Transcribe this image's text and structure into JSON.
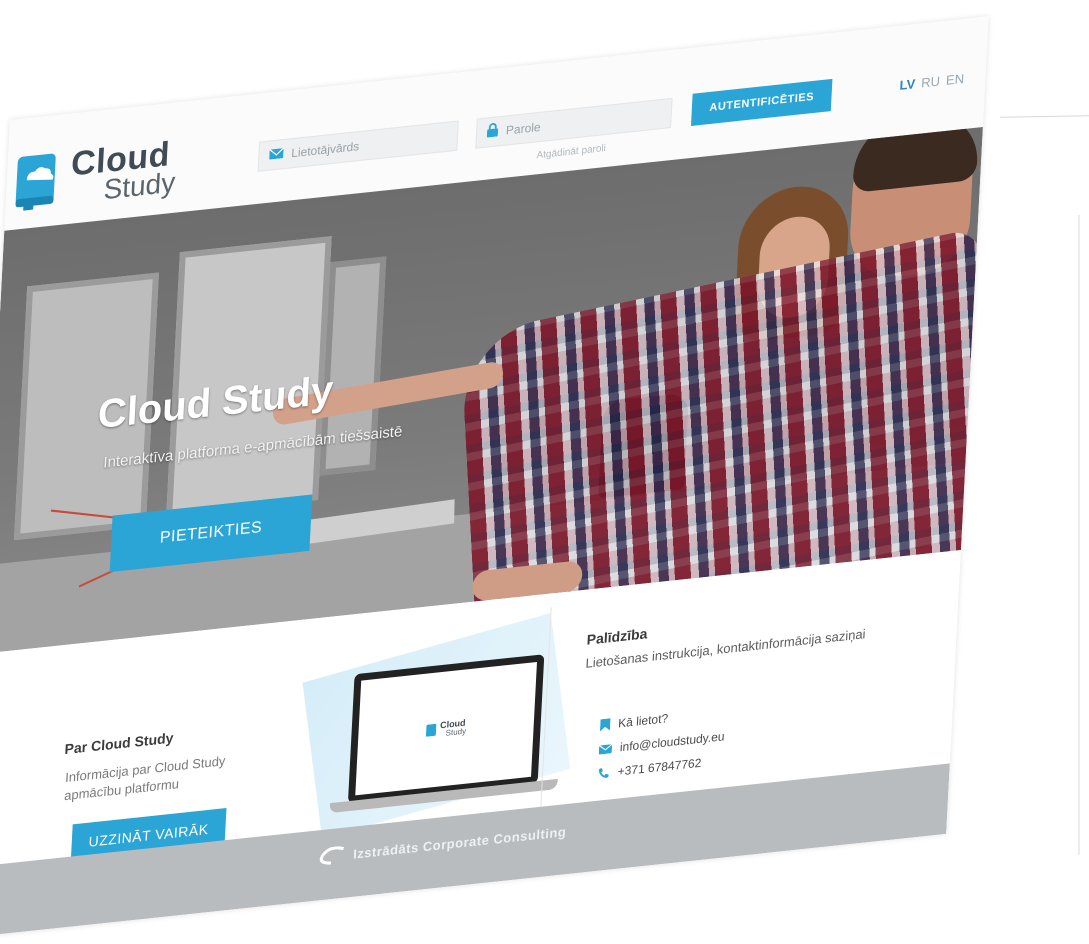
{
  "brand": {
    "line1": "Cloud",
    "line2": "Study"
  },
  "login": {
    "username_placeholder": "Lietotājvārds",
    "password_placeholder": "Parole",
    "forgot_label": "Atgādināt paroli",
    "submit_label": "AUTENTIFICĒTIES"
  },
  "languages": [
    {
      "code": "LV",
      "active": true
    },
    {
      "code": "RU",
      "active": false
    },
    {
      "code": "EN",
      "active": false
    }
  ],
  "hero": {
    "title": "Cloud Study",
    "subtitle": "Interaktīva platforma e-apmācībām tiešsaistē",
    "cta_label": "PIETEIKTIES"
  },
  "about": {
    "title": "Par Cloud Study",
    "text": "Informācija par Cloud Study apmācību platformu",
    "cta_label": "UZZINĀT VAIRĀK"
  },
  "laptop_logo": {
    "line1": "Cloud",
    "line2": "Study"
  },
  "help": {
    "title": "Palīdzība",
    "text": "Lietošanas instrukcija, kontaktinformācija saziņai",
    "links": [
      {
        "icon": "bookmark-icon",
        "label": "Kā lietot?"
      },
      {
        "icon": "mail-icon",
        "label": "info@cloudstudy.eu"
      },
      {
        "icon": "phone-icon",
        "label": "+371 67847762"
      }
    ]
  },
  "footer": {
    "label": "Izstrādāts Corporate Consulting"
  },
  "colors": {
    "accent": "#2aa5d6",
    "logo_text": "#3f4b55",
    "footer_bg": "#b9bcbf"
  }
}
